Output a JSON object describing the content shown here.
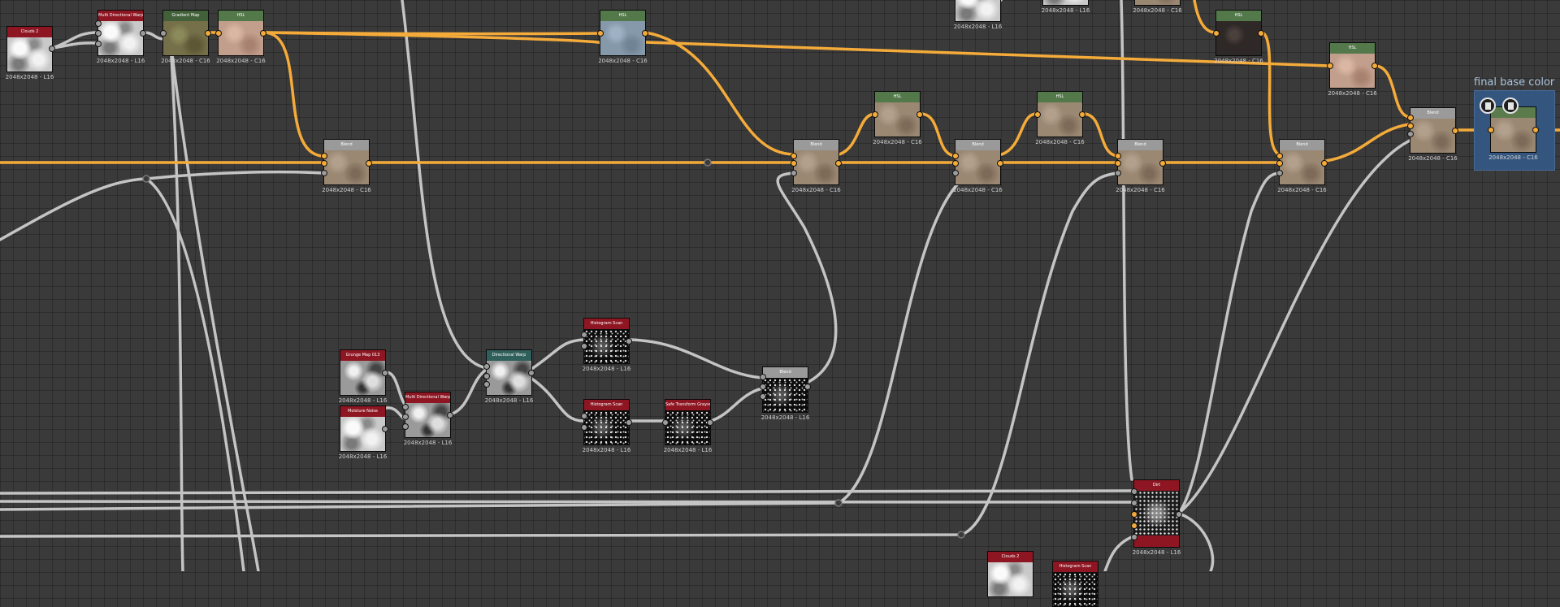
{
  "frame": {
    "title": "final base color"
  },
  "nodes": [
    {
      "id": "cloud-2-a",
      "title": "Clouds 2",
      "label": "2048x2048 - L16",
      "header": "#8e1622",
      "thumb": "clouds-light"
    },
    {
      "id": "mdw-a",
      "title": "Multi Directional Warp",
      "label": "2048x2048 - L16",
      "header": "#8e1622",
      "thumb": "clouds-light"
    },
    {
      "id": "gradient-map",
      "title": "Gradient Map",
      "label": "2048x2048 - C16",
      "header": "#42613a",
      "thumb": "olive"
    },
    {
      "id": "hsl-a",
      "title": "HSL",
      "label": "2048x2048 - C16",
      "header": "#53784a",
      "thumb": "pink"
    },
    {
      "id": "hsl-b",
      "title": "HSL",
      "label": "2048x2048 - C16",
      "header": "#53784a",
      "thumb": "blue"
    },
    {
      "id": "top-node-a",
      "title": "",
      "label": "2048x2048 - L16",
      "header": "#2b2b2b",
      "thumb": "clouds-light"
    },
    {
      "id": "top-node-b",
      "title": "",
      "label": "2048x2048 - L16",
      "header": "#2b2b2b",
      "thumb": "clouds-light"
    },
    {
      "id": "top-node-c",
      "title": "",
      "label": "2048x2048 - C16",
      "header": "#2b2b2b",
      "thumb": "brown"
    },
    {
      "id": "hsl-c",
      "title": "HSL",
      "label": "2048x2048 - C16",
      "header": "#53784a",
      "thumb": "dark"
    },
    {
      "id": "hsl-d",
      "title": "HSL",
      "label": "2048x2048 - C16",
      "header": "#53784a",
      "thumb": "pink"
    },
    {
      "id": "blend-a",
      "title": "Blend",
      "label": "2048x2048 - C16",
      "header": "#9a9a9a",
      "thumb": "brown"
    },
    {
      "id": "hsl-e",
      "title": "HSL",
      "label": "2048x2048 - C16",
      "header": "#53784a",
      "thumb": "brown"
    },
    {
      "id": "hsl-f",
      "title": "HSL",
      "label": "2048x2048 - C16",
      "header": "#53784a",
      "thumb": "brown"
    },
    {
      "id": "blend-b",
      "title": "Blend",
      "label": "2048x2048 - C16",
      "header": "#9a9a9a",
      "thumb": "brown"
    },
    {
      "id": "blend-c",
      "title": "Blend",
      "label": "2048x2048 - C16",
      "header": "#9a9a9a",
      "thumb": "brown"
    },
    {
      "id": "blend-d",
      "title": "Blend",
      "label": "2048x2048 - C16",
      "header": "#9a9a9a",
      "thumb": "brown"
    },
    {
      "id": "blend-e",
      "title": "Blend",
      "label": "2048x2048 - C16",
      "header": "#9a9a9a",
      "thumb": "brown"
    },
    {
      "id": "blend-f",
      "title": "Blend",
      "label": "2048x2048 - C16",
      "header": "#9a9a9a",
      "thumb": "brown"
    },
    {
      "id": "final-node",
      "title": "",
      "label": "2048x2048 - C16",
      "header": "#5b7b4c",
      "thumb": "brown"
    },
    {
      "id": "grunge-map",
      "title": "Grunge Map 013",
      "label": "2048x2048 - L16",
      "header": "#8e1622",
      "thumb": "clouds"
    },
    {
      "id": "moisture-noise",
      "title": "Moisture Noise",
      "label": "2048x2048 - L16",
      "header": "#8e1622",
      "thumb": "clouds-light"
    },
    {
      "id": "mdw-b",
      "title": "Multi Directional Warp",
      "label": "2048x2048 - L16",
      "header": "#8e1622",
      "thumb": "clouds"
    },
    {
      "id": "directional-warp",
      "title": "Directional Warp",
      "label": "2048x2048 - L16",
      "header": "#2f5f5a",
      "thumb": "clouds"
    },
    {
      "id": "histogram-scan-a",
      "title": "Histogram Scan",
      "label": "2048x2048 - L16",
      "header": "#8e1622",
      "thumb": "speckle"
    },
    {
      "id": "histogram-scan-b",
      "title": "Histogram Scan",
      "label": "2048x2048 - L16",
      "header": "#8e1622",
      "thumb": "speckle"
    },
    {
      "id": "safe-transform",
      "title": "Safe Transform Grayscale",
      "label": "2048x2048 - L16",
      "header": "#8e1622",
      "thumb": "speckle"
    },
    {
      "id": "blend-g",
      "title": "Blend",
      "label": "2048x2048 - L16",
      "header": "#9a9a9a",
      "thumb": "speckle"
    },
    {
      "id": "dirt",
      "title": "Dirt",
      "label": "2048x2048 - L16",
      "header": "#8e1622",
      "thumb": "dirt"
    },
    {
      "id": "cloud-2-b",
      "title": "Clouds 2",
      "label": "",
      "header": "#8e1622",
      "thumb": "clouds-light"
    },
    {
      "id": "histogram-scan-c",
      "title": "Histogram Scan",
      "label": "",
      "header": "#8e1622",
      "thumb": "speckle"
    }
  ]
}
